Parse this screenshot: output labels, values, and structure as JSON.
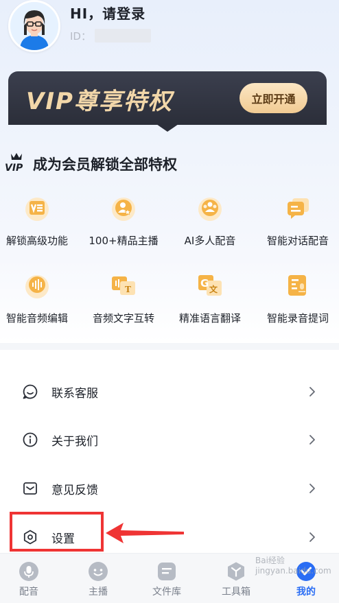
{
  "profile": {
    "greeting": "HI，请登录",
    "id_label": "ID："
  },
  "vip_banner": {
    "title": "VIP尊享特权",
    "button": "立即开通"
  },
  "member_section": {
    "badge": "VIP",
    "title": "成为会员解锁全部特权",
    "features": [
      {
        "label": "解锁高级功能",
        "icon": "unlock-feature-icon"
      },
      {
        "label": "100+精品主播",
        "icon": "anchor-icon"
      },
      {
        "label": "AI多人配音",
        "icon": "multi-voice-icon"
      },
      {
        "label": "智能对话配音",
        "icon": "dialog-dubbing-icon"
      },
      {
        "label": "智能音频编辑",
        "icon": "audio-edit-icon"
      },
      {
        "label": "音频文字互转",
        "icon": "audio-text-icon"
      },
      {
        "label": "精准语言翻译",
        "icon": "translate-icon"
      },
      {
        "label": "智能录音提词",
        "icon": "teleprompter-icon"
      }
    ]
  },
  "menu": [
    {
      "label": "联系客服",
      "icon": "customer-service-icon"
    },
    {
      "label": "关于我们",
      "icon": "info-icon"
    },
    {
      "label": "意见反馈",
      "icon": "feedback-icon"
    },
    {
      "label": "设置",
      "icon": "settings-icon"
    }
  ],
  "bottom_nav": [
    {
      "label": "配音",
      "icon": "mic-icon",
      "active": false
    },
    {
      "label": "主播",
      "icon": "face-icon",
      "active": false
    },
    {
      "label": "文件库",
      "icon": "file-library-icon",
      "active": false
    },
    {
      "label": "工具箱",
      "icon": "toolbox-icon",
      "active": false
    },
    {
      "label": "我的",
      "icon": "profile-icon",
      "active": true
    }
  ],
  "watermark": "Bai经验 jingyan.baidu.com",
  "colors": {
    "accent": "#2a6df4",
    "vip_gold": "#f2d7a9",
    "icon_orange": "#f0a024",
    "highlight_red": "#ef3434"
  }
}
